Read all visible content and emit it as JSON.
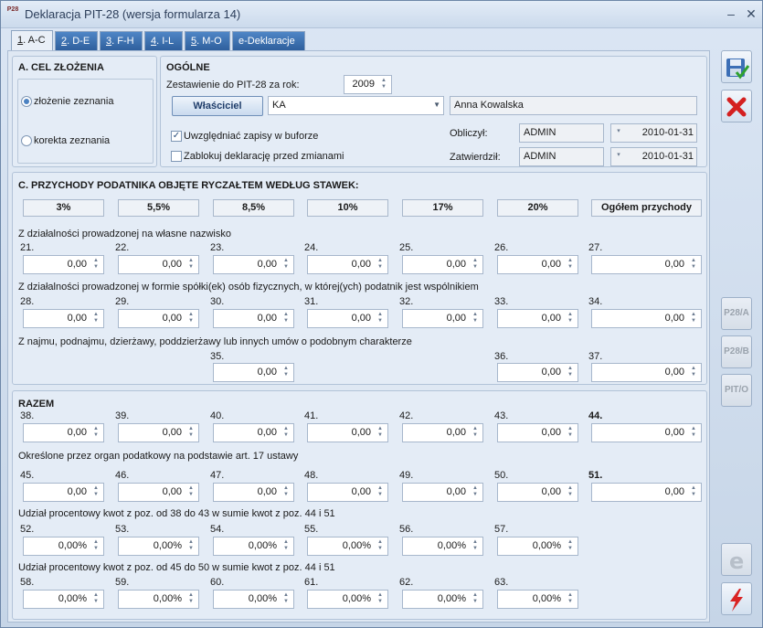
{
  "window": {
    "title": "Deklaracja PIT-28 (wersja formularza 14)",
    "app_icon_label": "P28"
  },
  "tabs": [
    {
      "num": "1",
      "label": ". A-C"
    },
    {
      "num": "2",
      "label": ". D-E"
    },
    {
      "num": "3",
      "label": ". F-H"
    },
    {
      "num": "4",
      "label": ". I-L"
    },
    {
      "num": "5",
      "label": ". M-O"
    },
    {
      "num": "",
      "label": "e-Deklaracje"
    }
  ],
  "section_a": {
    "title": "A. CEL ZŁOŻENIA",
    "option1": "złożenie zeznania",
    "option2": "korekta zeznania",
    "selected": "option1"
  },
  "general": {
    "title": "OGÓLNE",
    "year_label": "Zestawienie do PIT-28 za rok:",
    "year_value": "2009",
    "owner_button": "Właściciel",
    "owner_code": "KA",
    "owner_name": "Anna Kowalska",
    "buffer_label": "Uwzględniać zapisy w buforze",
    "buffer_checked": true,
    "lock_label": "Zablokuj deklarację przed zmianami",
    "lock_checked": false,
    "calculated_label": "Obliczył:",
    "calculated_user": "ADMIN",
    "calculated_date": "2010-01-31",
    "approved_label": "Zatwierdził:",
    "approved_user": "ADMIN",
    "approved_date": "2010-01-31"
  },
  "section_c": {
    "title": "C. PRZYCHODY PODATNIKA OBJĘTE RYCZAŁTEM WEDŁUG STAWEK:",
    "rates": [
      "3%",
      "5,5%",
      "8,5%",
      "10%",
      "17%",
      "20%",
      "Ogółem przychody"
    ],
    "row1_label": "Z działalności prowadzonej na własne nazwisko",
    "row1_nums": [
      "21.",
      "22.",
      "23.",
      "24.",
      "25.",
      "26.",
      "27."
    ],
    "row1_vals": [
      "0,00",
      "0,00",
      "0,00",
      "0,00",
      "0,00",
      "0,00",
      "0,00"
    ],
    "row2_label": "Z działalności prowadzonej w formie spółki(ek) osób fizycznych, w której(ych) podatnik jest wspólnikiem",
    "row2_nums": [
      "28.",
      "29.",
      "30.",
      "31.",
      "32.",
      "33.",
      "34."
    ],
    "row2_vals": [
      "0,00",
      "0,00",
      "0,00",
      "0,00",
      "0,00",
      "0,00",
      "0,00"
    ],
    "row3_label": "Z najmu, podnajmu, dzierżawy, poddzierżawy lub innych umów o podobnym charakterze",
    "row3_nums": [
      "35.",
      "36.",
      "37."
    ],
    "row3_vals": [
      "0,00",
      "0,00",
      "0,00"
    ]
  },
  "totals": {
    "title": "RAZEM",
    "row1_nums": [
      "38.",
      "39.",
      "40.",
      "41.",
      "42.",
      "43.",
      "44."
    ],
    "row1_vals": [
      "0,00",
      "0,00",
      "0,00",
      "0,00",
      "0,00",
      "0,00",
      "0,00"
    ],
    "row2_label": "Określone przez organ podatkowy na podstawie art. 17 ustawy",
    "row2_nums": [
      "45.",
      "46.",
      "47.",
      "48.",
      "49.",
      "50.",
      "51."
    ],
    "row2_vals": [
      "0,00",
      "0,00",
      "0,00",
      "0,00",
      "0,00",
      "0,00",
      "0,00"
    ],
    "row3_label": "Udział procentowy kwot z poz. od 38 do 43 w sumie kwot z poz. 44 i 51",
    "row3_nums": [
      "52.",
      "53.",
      "54.",
      "55.",
      "56.",
      "57."
    ],
    "row3_vals": [
      "0,00%",
      "0,00%",
      "0,00%",
      "0,00%",
      "0,00%",
      "0,00%"
    ],
    "row4_label": "Udział procentowy kwot z poz. od 45 do 50 w sumie kwot z poz. 44 i 51",
    "row4_nums": [
      "58.",
      "59.",
      "60.",
      "61.",
      "62.",
      "63."
    ],
    "row4_vals": [
      "0,00%",
      "0,00%",
      "0,00%",
      "0,00%",
      "0,00%",
      "0,00%"
    ]
  },
  "side": {
    "p28a": "P28/A",
    "p28b": "P28/B",
    "pito": "PIT/O"
  }
}
